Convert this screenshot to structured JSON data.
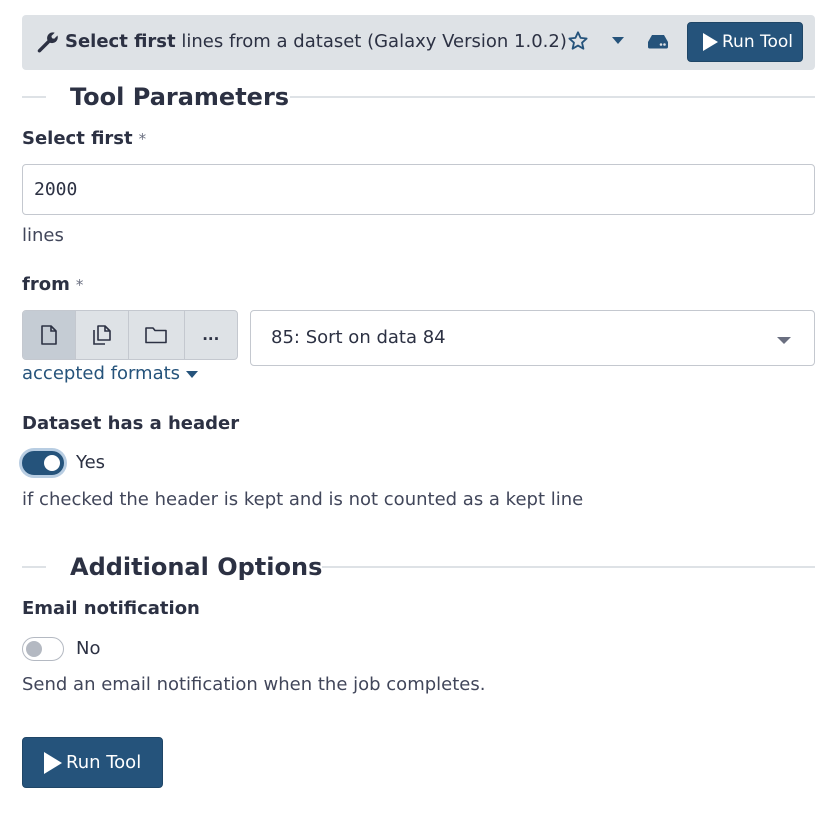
{
  "header": {
    "title_bold": "Select first",
    "title_rest": " lines from a dataset (Galaxy Version 1.0.2)",
    "run_label": "Run Tool",
    "icons": [
      "wrench-icon",
      "star-icon",
      "caret-down-icon",
      "storage-icon",
      "play-icon"
    ]
  },
  "sections": {
    "tool_parameters": "Tool Parameters",
    "additional_options": "Additional Options"
  },
  "params": {
    "select_first": {
      "label": "Select first",
      "required_mark": "*",
      "value": "2000",
      "help": "lines"
    },
    "from": {
      "label": "from",
      "required_mark": "*",
      "source_buttons": [
        "single-dataset-icon",
        "multiple-datasets-icon",
        "collection-folder-icon",
        "more-options-icon"
      ],
      "more_glyph": "...",
      "selected": "85: Sort on data 84",
      "accepted_formats": "accepted formats"
    },
    "header": {
      "label": "Dataset has a header",
      "value_label": "Yes",
      "checked": true,
      "help": "if checked the header is kept and is not counted as a kept line"
    }
  },
  "email": {
    "label": "Email notification",
    "value_label": "No",
    "checked": false,
    "help": "Send an email notification when the job completes."
  },
  "footer": {
    "run_label": "Run Tool"
  },
  "colors": {
    "primary": "#25537b",
    "header_bg": "#dee2e6",
    "text": "#2c3143"
  }
}
